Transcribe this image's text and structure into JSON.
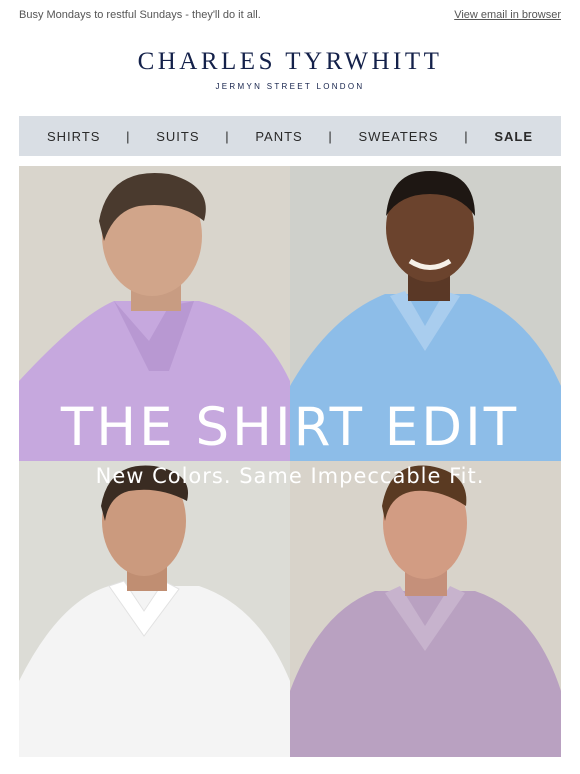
{
  "preheader": {
    "text": "Busy Mondays to restful Sundays - they'll do it all.",
    "view_in_browser": "View email in browser"
  },
  "brand": {
    "name": "CHARLES TYRWHITT",
    "tagline": "JERMYN STREET LONDON",
    "color": "#14214a"
  },
  "nav": {
    "items": [
      "SHIRTS",
      "SUITS",
      "PANTS",
      "SWEATERS",
      "SALE"
    ],
    "separator": "|",
    "background": "#d9dee4"
  },
  "hero": {
    "title": "THE SHIRT EDIT",
    "subtitle": "New Colors. Same Impeccable Fit.",
    "shirt_colors": [
      "#c6a8de",
      "#8dbde8",
      "#f4f4f4",
      "#b9a1c1"
    ]
  }
}
